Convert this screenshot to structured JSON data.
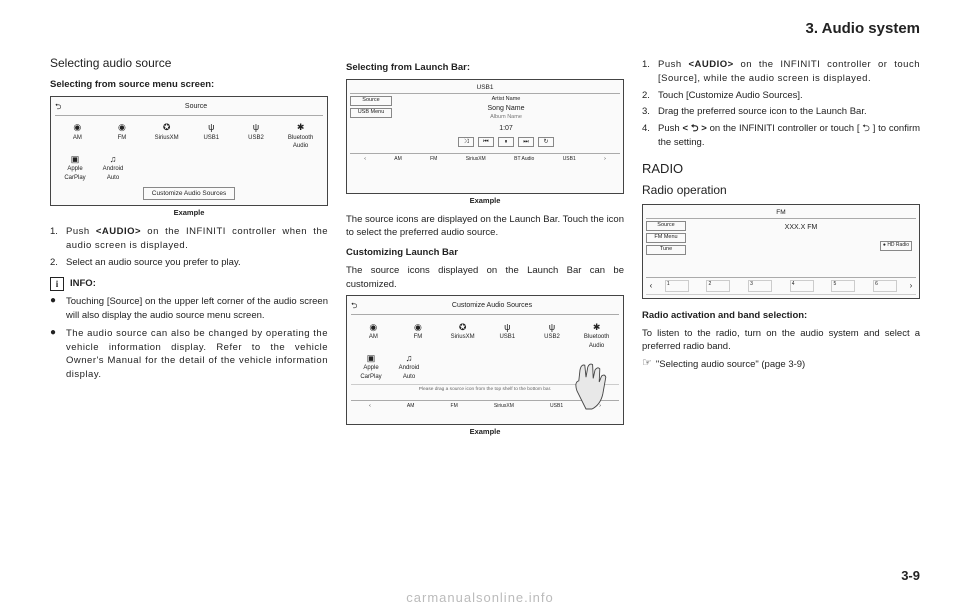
{
  "chapter": "3. Audio system",
  "page_number": "3-9",
  "watermark": "carmanualsonline.info",
  "col1": {
    "h1": "Selecting audio source",
    "sub1": "Selecting from source menu screen:",
    "fig1": {
      "back": "⮌",
      "title": "Source",
      "items": [
        "AM",
        "FM",
        "SiriusXM",
        "USB1",
        "USB2",
        "Bluetooth Audio"
      ],
      "items2": [
        "Apple CarPlay",
        "Android Auto"
      ],
      "cust": "Customize Audio Sources",
      "caption": "Example"
    },
    "step1": "Push <AUDIO> on the INFINITI controller when the audio screen is displayed.",
    "step2": "Select an audio source you prefer to play.",
    "info_label": "INFO:",
    "bullet1": "Touching [Source] on the upper left corner of the audio screen will also display the audio source menu screen.",
    "bullet2": "The audio source can also be changed by operating the vehicle information display. Refer to the vehicle Owner's Manual for the detail of the vehicle information display."
  },
  "col2": {
    "sub1": "Selecting from Launch Bar:",
    "fig2": {
      "top": "USB1",
      "btn_source": "Source",
      "btn_menu": "USB Menu",
      "artist": "Artist Name",
      "song": "Song Name",
      "album": "Album Name",
      "time": "1:07",
      "launch": [
        "AM",
        "FM",
        "SiriusXM",
        "BT Audio",
        "USB1"
      ],
      "caption": "Example"
    },
    "p1": "The source icons are displayed on the Launch Bar. Touch the icon to select the preferred audio source.",
    "sub2": "Customizing Launch Bar",
    "p2": "The source icons displayed on the Launch Bar can be customized.",
    "fig3": {
      "title": "Customize Audio Sources",
      "row1": [
        "AM",
        "FM",
        "SiriusXM",
        "USB1",
        "USB2",
        "Bluetooth Audio"
      ],
      "row2": [
        "Apple CarPlay",
        "Android Auto"
      ],
      "hint": "Please drag a source icon from the top shelf to the bottom bar.",
      "launch": [
        "AM",
        "FM",
        "SiriusXM",
        "USB1"
      ],
      "caption": "Example"
    }
  },
  "col3": {
    "step1": "Push <AUDIO> on the INFINITI controller or touch [Source], while the audio screen is displayed.",
    "step2": "Touch [Customize Audio Sources].",
    "step3": "Drag the preferred source icon to the Launch Bar.",
    "step4": "Push < ⮌ > on the INFINITI controller or touch [ ⮌ ] to confirm the setting.",
    "h_radio": "RADIO",
    "h_radio_op": "Radio operation",
    "fig4": {
      "band": "FM",
      "freq": "XXX.X FM",
      "btn_source": "Source",
      "btn_menu": "FM Menu",
      "btn_tune": "Tune",
      "hd": "● HD Radio",
      "presets": [
        "1",
        "2",
        "3",
        "4",
        "5",
        "6"
      ]
    },
    "sub1": "Radio activation and band selection:",
    "p1": "To listen to the radio, turn on the audio system and select a preferred radio band.",
    "xref": "\"Selecting audio source\" (page 3-9)"
  }
}
